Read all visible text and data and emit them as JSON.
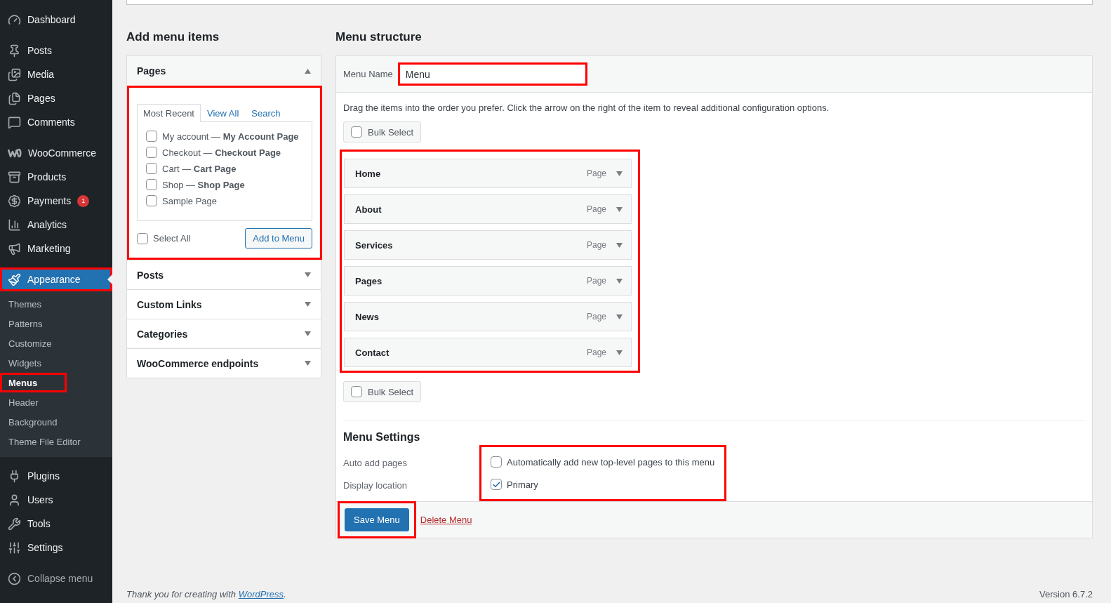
{
  "sidebar": {
    "groups": [
      [
        {
          "label": "Dashboard",
          "selected": false,
          "highlighted": false
        }
      ],
      [
        {
          "label": "Posts",
          "selected": false,
          "highlighted": false
        },
        {
          "label": "Media",
          "selected": false,
          "highlighted": false
        },
        {
          "label": "Pages",
          "selected": false,
          "highlighted": false
        },
        {
          "label": "Comments",
          "selected": false,
          "highlighted": false
        }
      ],
      [
        {
          "label": "WooCommerce",
          "selected": false,
          "highlighted": false
        },
        {
          "label": "Products",
          "selected": false,
          "highlighted": false
        },
        {
          "label": "Payments",
          "badge": "1",
          "selected": false,
          "highlighted": false
        },
        {
          "label": "Analytics",
          "selected": false,
          "highlighted": false
        },
        {
          "label": "Marketing",
          "selected": false,
          "highlighted": false
        }
      ],
      [
        {
          "label": "Appearance",
          "selected": true,
          "highlighted": true,
          "submenu": [
            {
              "label": "Themes",
              "selected": false,
              "highlighted": false
            },
            {
              "label": "Patterns",
              "selected": false,
              "highlighted": false
            },
            {
              "label": "Customize",
              "selected": false,
              "highlighted": false
            },
            {
              "label": "Widgets",
              "selected": false,
              "highlighted": false
            },
            {
              "label": "Menus",
              "selected": true,
              "highlighted": true
            },
            {
              "label": "Header",
              "selected": false,
              "highlighted": false
            },
            {
              "label": "Background",
              "selected": false,
              "highlighted": false
            },
            {
              "label": "Theme File Editor",
              "selected": false,
              "highlighted": false
            }
          ]
        }
      ],
      [
        {
          "label": "Plugins",
          "selected": false,
          "highlighted": false
        },
        {
          "label": "Users",
          "selected": false,
          "highlighted": false
        },
        {
          "label": "Tools",
          "selected": false,
          "highlighted": false
        },
        {
          "label": "Settings",
          "selected": false,
          "highlighted": false
        }
      ],
      [
        {
          "label": "Collapse menu",
          "selected": false,
          "highlighted": false
        }
      ]
    ]
  },
  "add_items": {
    "title": "Add menu items",
    "panels": [
      {
        "title": "Pages",
        "expanded": true,
        "highlighted": true,
        "tabs": [
          {
            "label": "Most Recent",
            "selected": true
          },
          {
            "label": "View All",
            "selected": false
          },
          {
            "label": "Search",
            "selected": false
          }
        ],
        "items": [
          {
            "label": "My account — **My Account Page**",
            "checked": false
          },
          {
            "label": "Checkout — **Checkout Page**",
            "checked": false
          },
          {
            "label": "Cart — **Cart Page**",
            "checked": false
          },
          {
            "label": "Shop — **Shop Page**",
            "checked": false
          },
          {
            "label": "Sample Page",
            "checked": false
          }
        ],
        "select_all": {
          "label": "Select All",
          "checked": false
        },
        "button": "Add to Menu"
      },
      {
        "title": "Posts",
        "expanded": false
      },
      {
        "title": "Custom Links",
        "expanded": false
      },
      {
        "title": "Categories",
        "expanded": false
      },
      {
        "title": "WooCommerce endpoints",
        "expanded": false
      }
    ]
  },
  "structure": {
    "title": "Menu structure",
    "menu_name_label": "Menu Name",
    "menu_name": "Menu",
    "menu_name_highlighted": true,
    "instructions": "Drag the items into the order you prefer. Click the arrow on the right of the item to reveal additional configuration options.",
    "bulk_select_top": {
      "label": "Bulk Select",
      "checked": false
    },
    "items_highlighted": true,
    "items": [
      {
        "title": "Home",
        "type": "Page"
      },
      {
        "title": "About",
        "type": "Page"
      },
      {
        "title": "Services",
        "type": "Page"
      },
      {
        "title": "Pages",
        "type": "Page"
      },
      {
        "title": "News",
        "type": "Page"
      },
      {
        "title": "Contact",
        "type": "Page"
      }
    ],
    "bulk_select_bottom": {
      "label": "Bulk Select",
      "checked": false
    },
    "settings": {
      "title": "Menu Settings",
      "highlighted": true,
      "rows": [
        {
          "label": "Auto add pages",
          "option": "Automatically add new top-level pages to this menu",
          "checked": false
        },
        {
          "label": "Display location",
          "option": "Primary",
          "checked": true
        }
      ]
    },
    "save_button": "Save Menu",
    "save_highlighted": true,
    "delete_link": "Delete Menu"
  },
  "footer": {
    "credit_before": "Thank you for creating with ",
    "credit_link": "WordPress",
    "credit_after": ".",
    "version": "Version 6.7.2"
  }
}
